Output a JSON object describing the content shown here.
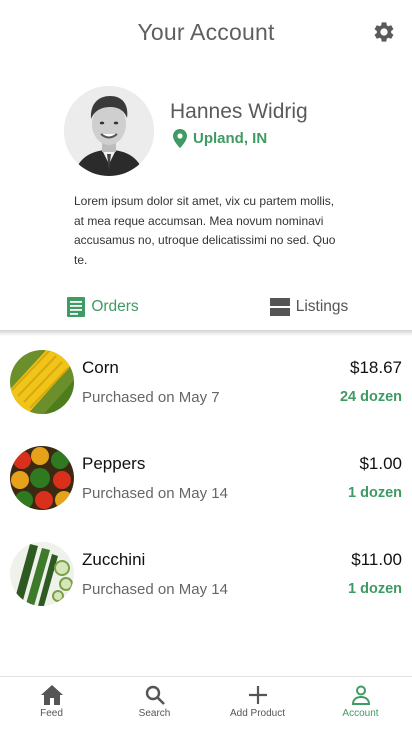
{
  "header": {
    "title": "Your Account",
    "settings_icon": "gear-icon"
  },
  "profile": {
    "name": "Hannes Widrig",
    "location": "Upland, IN",
    "location_icon": "map-pin-icon",
    "bio": "Lorem ipsum dolor sit amet, vix cu partem mollis, at mea reque accumsan. Mea novum nominavi accusamus no, utroque delicatissimi no sed. Quo te."
  },
  "tabs": [
    {
      "label": "Orders",
      "icon": "receipt-icon",
      "active": true
    },
    {
      "label": "Listings",
      "icon": "listings-icon",
      "active": false
    }
  ],
  "orders": [
    {
      "name": "Corn",
      "date": "Purchased on May 7",
      "price": "$18.67",
      "quantity": "24 dozen"
    },
    {
      "name": "Peppers",
      "date": "Purchased on May 14",
      "price": "$1.00",
      "quantity": "1 dozen"
    },
    {
      "name": "Zucchini",
      "date": "Purchased on May 14",
      "price": "$11.00",
      "quantity": "1 dozen"
    }
  ],
  "nav": [
    {
      "label": "Feed",
      "icon": "home-icon"
    },
    {
      "label": "Search",
      "icon": "search-icon"
    },
    {
      "label": "Add Product",
      "icon": "plus-icon"
    },
    {
      "label": "Account",
      "icon": "person-icon",
      "active": true
    }
  ],
  "colors": {
    "accent": "#3f9a63",
    "title": "#5f5f5f"
  }
}
